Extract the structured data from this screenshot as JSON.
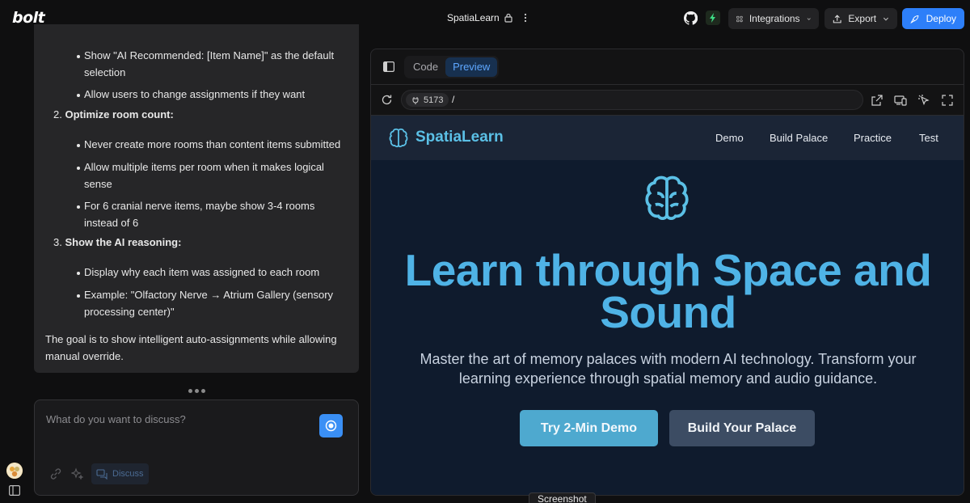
{
  "app": {
    "logo": "bolt",
    "project_name": "SpatiaLearn"
  },
  "toolbar": {
    "integrations_label": "Integrations",
    "export_label": "Export",
    "deploy_label": "Deploy"
  },
  "chat": {
    "sub_bullets_top": [
      "Show \"AI Recommended: [Item Name]\" as the default selection",
      "Allow users to change assignments if they want"
    ],
    "sections": [
      {
        "number": "2.",
        "title": "Optimize room count:",
        "bullets": [
          "Never create more rooms than content items submitted",
          "Allow multiple items per room when it makes logical sense",
          "For 6 cranial nerve items, maybe show 3-4 rooms instead of 6"
        ]
      },
      {
        "number": "3.",
        "title": "Show the AI reasoning:",
        "bullets": [
          "Display why each item was assigned to each room",
          "Example: \"Olfactory Nerve → Atrium Gallery (sensory processing center)\""
        ]
      }
    ],
    "closing": "The goal is to show intelligent auto-assignments while allowing manual override.",
    "input_placeholder": "What do you want to discuss?",
    "discuss_label": "Discuss"
  },
  "preview": {
    "tabs": [
      "Code",
      "Preview"
    ],
    "active_tab": "Preview",
    "port": "5173",
    "path": "/",
    "screenshot_label": "Screenshot"
  },
  "site": {
    "brand": "SpatiaLearn",
    "nav": [
      "Demo",
      "Build Palace",
      "Practice",
      "Test"
    ],
    "hero_title": "Learn through Space and Sound",
    "hero_subtitle": "Master the art of memory palaces with modern AI technology. Transform your learning experience through spatial memory and audio guidance.",
    "cta_primary": "Try 2-Min Demo",
    "cta_secondary": "Build Your Palace"
  },
  "colors": {
    "accent": "#2d7ff9",
    "site_brand": "#5bc0e6",
    "site_bg": "#0f1b2d"
  }
}
